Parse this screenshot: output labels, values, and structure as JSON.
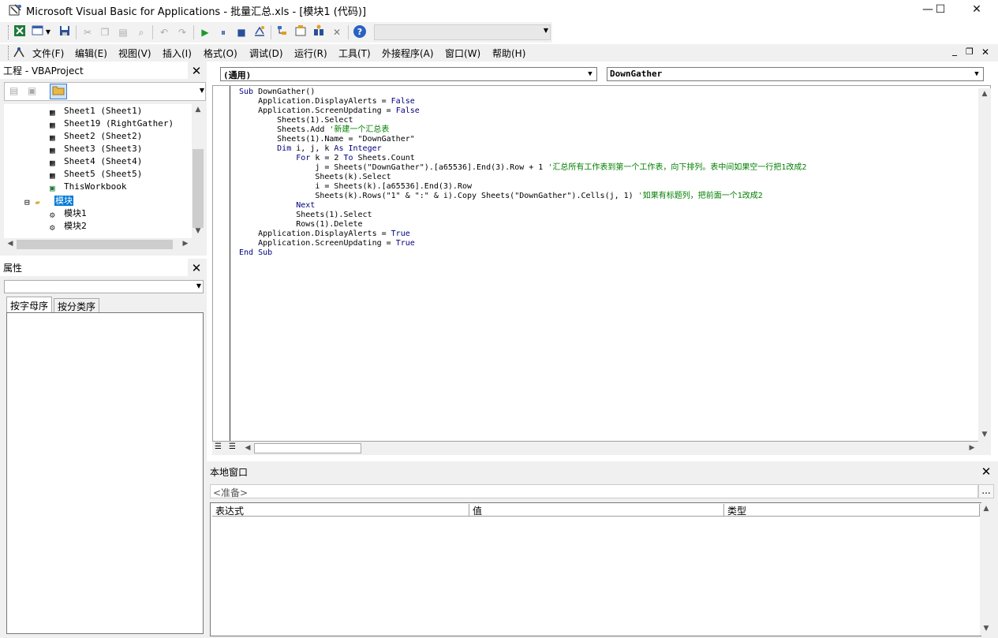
{
  "window": {
    "title": "Microsoft Visual Basic for Applications - 批量汇总.xls - [模块1 (代码)]",
    "minimize": "—",
    "maximize": "☐",
    "close": "✕"
  },
  "toolbar": {
    "icons": [
      "excel-icon",
      "insert-userform-icon",
      "save-icon",
      "cut-icon",
      "copy-icon",
      "paste-icon",
      "find-icon",
      "undo-icon",
      "redo-icon",
      "run-icon",
      "break-icon",
      "reset-icon",
      "design-mode-icon",
      "project-explorer-icon",
      "properties-icon",
      "object-browser-icon",
      "toolbox-icon",
      "help-icon"
    ]
  },
  "menu": {
    "items": [
      "文件(F)",
      "编辑(E)",
      "视图(V)",
      "插入(I)",
      "格式(O)",
      "调试(D)",
      "运行(R)",
      "工具(T)",
      "外接程序(A)",
      "窗口(W)",
      "帮助(H)"
    ]
  },
  "project": {
    "title": "工程 - VBAProject",
    "items": [
      {
        "label": "Sheet1 (Sheet1)",
        "type": "sheet"
      },
      {
        "label": "Sheet19 (RightGather)",
        "type": "sheet"
      },
      {
        "label": "Sheet2 (Sheet2)",
        "type": "sheet"
      },
      {
        "label": "Sheet3 (Sheet3)",
        "type": "sheet"
      },
      {
        "label": "Sheet4 (Sheet4)",
        "type": "sheet"
      },
      {
        "label": "Sheet5 (Sheet5)",
        "type": "sheet"
      },
      {
        "label": "ThisWorkbook",
        "type": "workbook"
      },
      {
        "label": "模块",
        "type": "folder"
      },
      {
        "label": "模块1",
        "type": "module"
      },
      {
        "label": "模块2",
        "type": "module"
      }
    ]
  },
  "properties": {
    "title": "属性",
    "tabs": [
      "按字母序",
      "按分类序"
    ]
  },
  "code": {
    "object_combo": "(通用)",
    "proc_combo": "DownGather",
    "lines": [
      {
        "kw": "Sub ",
        "text": "DownGather()",
        "cm": ""
      },
      {
        "kw": "",
        "text": "    Application.DisplayAlerts = ",
        "kw2": "False",
        "cm": ""
      },
      {
        "kw": "",
        "text": "    Application.ScreenUpdating = ",
        "kw2": "False",
        "cm": ""
      },
      {
        "kw": "",
        "text": "        Sheets(1).Select",
        "cm": ""
      },
      {
        "kw": "",
        "text": "        Sheets.Add ",
        "cm": "'新建一个汇总表"
      },
      {
        "kw": "",
        "text": "        Sheets(1).Name = \"DownGather\"",
        "cm": ""
      },
      {
        "kw": "        Dim ",
        "text": "i, j, k ",
        "kw2": "As Integer",
        "cm": ""
      },
      {
        "kw": "            For ",
        "text": "k = 2 ",
        "kw2": "To",
        "text2": " Sheets.Count",
        "cm": ""
      },
      {
        "kw": "",
        "text": "                j = Sheets(\"DownGather\").[a65536].End(3).Row + 1 ",
        "cm": "'汇总所有工作表到第一个工作表，向下排列。表中间如果空一行把1改成2"
      },
      {
        "kw": "",
        "text": "                Sheets(k).Select",
        "cm": ""
      },
      {
        "kw": "",
        "text": "                i = Sheets(k).[a65536].End(3).Row",
        "cm": ""
      },
      {
        "kw": "",
        "text": "                Sheets(k).Rows(\"1\" & \":\" & i).Copy Sheets(\"DownGather\").Cells(j, 1) ",
        "cm": "'如果有标题列，把前面一个1改成2"
      },
      {
        "kw": "            Next",
        "text": "",
        "cm": ""
      },
      {
        "kw": "",
        "text": "            Sheets(1).Select",
        "cm": ""
      },
      {
        "kw": "",
        "text": "            Rows(1).Delete",
        "cm": ""
      },
      {
        "kw": "",
        "text": "    Application.DisplayAlerts = ",
        "kw2": "True",
        "cm": ""
      },
      {
        "kw": "",
        "text": "    Application.ScreenUpdating = ",
        "kw2": "True",
        "cm": ""
      },
      {
        "kw": "End Sub",
        "text": "",
        "cm": ""
      }
    ]
  },
  "locals": {
    "title": "本地窗口",
    "status": "<准备>",
    "ellipsis": "...",
    "columns": [
      "表达式",
      "值",
      "类型"
    ]
  }
}
